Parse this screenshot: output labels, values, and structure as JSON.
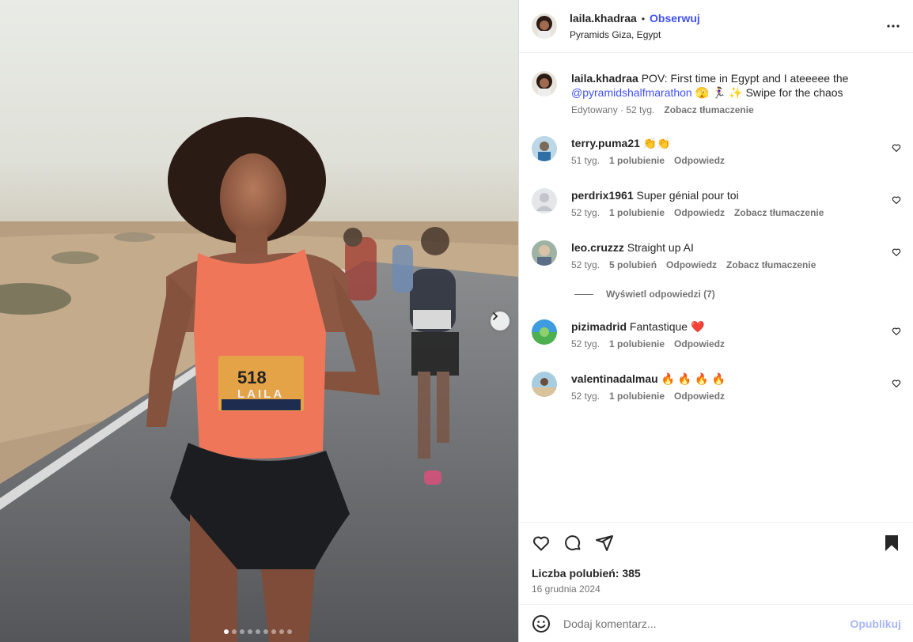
{
  "post": {
    "username": "laila.khadraa",
    "separator": "•",
    "follow_label": "Obserwuj",
    "location": "Pyramids Giza, Egypt"
  },
  "caption": {
    "username": "laila.khadraa",
    "text_before": "POV: First time in Egypt and I ateeeee the",
    "mention": "@pyramidshalfmarathon",
    "text_after": "🫣 🏃‍♀️ ✨  Swipe for the chaos",
    "edited": "Edytowany · 52 tyg.",
    "see_translation": "Zobacz tłumaczenie"
  },
  "comments": [
    {
      "username": "terry.puma21",
      "text": "👏👏",
      "time": "51 tyg.",
      "likes": "1 polubienie",
      "reply": "Odpowiedz",
      "translate": ""
    },
    {
      "username": "perdrix1961",
      "text": "Super génial pour toi",
      "time": "52 tyg.",
      "likes": "1 polubienie",
      "reply": "Odpowiedz",
      "translate": "Zobacz tłumaczenie"
    },
    {
      "username": "leo.cruzzz",
      "text": "Straight up AI",
      "time": "52 tyg.",
      "likes": "5 polubień",
      "reply": "Odpowiedz",
      "translate": "Zobacz tłumaczenie"
    },
    {
      "username": "pizimadrid",
      "text": "Fantastique ❤️",
      "time": "52 tyg.",
      "likes": "1 polubienie",
      "reply": "Odpowiedz",
      "translate": ""
    },
    {
      "username": "valentinadalmau",
      "text": "🔥 🔥 🔥 🔥",
      "time": "52 tyg.",
      "likes": "1 polubienie",
      "reply": "Odpowiedz",
      "translate": ""
    }
  ],
  "view_replies": "Wyświetl odpowiedzi (7)",
  "likes_label": "Liczba polubień: 385",
  "date": "16 grudnia 2024",
  "comment_input": {
    "placeholder": "Dodaj komentarz..."
  },
  "publish_label": "Opublikuj",
  "bib": {
    "number": "518",
    "name": "LAILA"
  },
  "carousel": {
    "total": 9,
    "active": 1
  },
  "icons": [
    "more-icon",
    "heart-icon",
    "comment-icon",
    "share-icon",
    "bookmark-icon",
    "emoji-icon",
    "chevron-right-icon"
  ],
  "colors": {
    "link": "#4150f7",
    "muted": "#737373",
    "publish_disabled": "#a8b6f9",
    "tank_top": "#f0765a"
  }
}
